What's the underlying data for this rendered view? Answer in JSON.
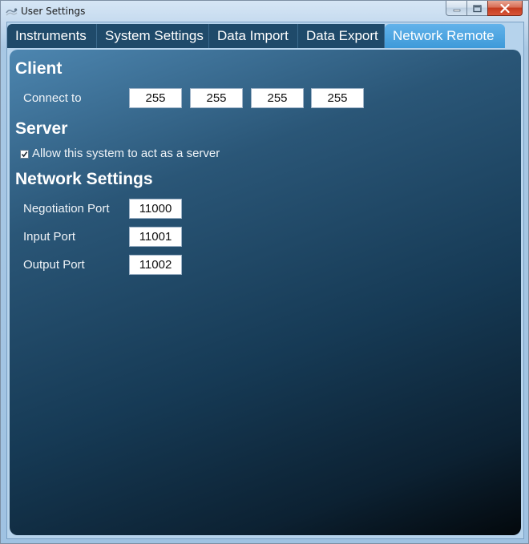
{
  "window": {
    "title": "User Settings"
  },
  "tabs": [
    {
      "label": "Instruments",
      "active": false
    },
    {
      "label": "System Settings",
      "active": false
    },
    {
      "label": "Data Import",
      "active": false
    },
    {
      "label": "Data Export",
      "active": false
    },
    {
      "label": "Network Remote",
      "active": true
    }
  ],
  "client": {
    "heading": "Client",
    "connect_label": "Connect to",
    "ip_octets": [
      "255",
      "255",
      "255",
      "255"
    ]
  },
  "server": {
    "heading": "Server",
    "allow_label": "Allow this system to act as a server",
    "allow_checked": true
  },
  "network_settings": {
    "heading": "Network Settings",
    "negotiation_port_label": "Negotiation Port",
    "negotiation_port": "11000",
    "input_port_label": "Input Port",
    "input_port": "11001",
    "output_port_label": "Output Port",
    "output_port": "11002"
  },
  "colors": {
    "active_tab": "#3e9ad9",
    "inactive_tab": "#1f4a6a",
    "panel_dark": "#03080c",
    "panel_light": "#4d86b0"
  },
  "icons": {
    "app": "app-logo-icon",
    "minimize": "minimize-icon",
    "maximize": "maximize-icon",
    "close": "close-icon",
    "check": "checkmark-icon"
  }
}
